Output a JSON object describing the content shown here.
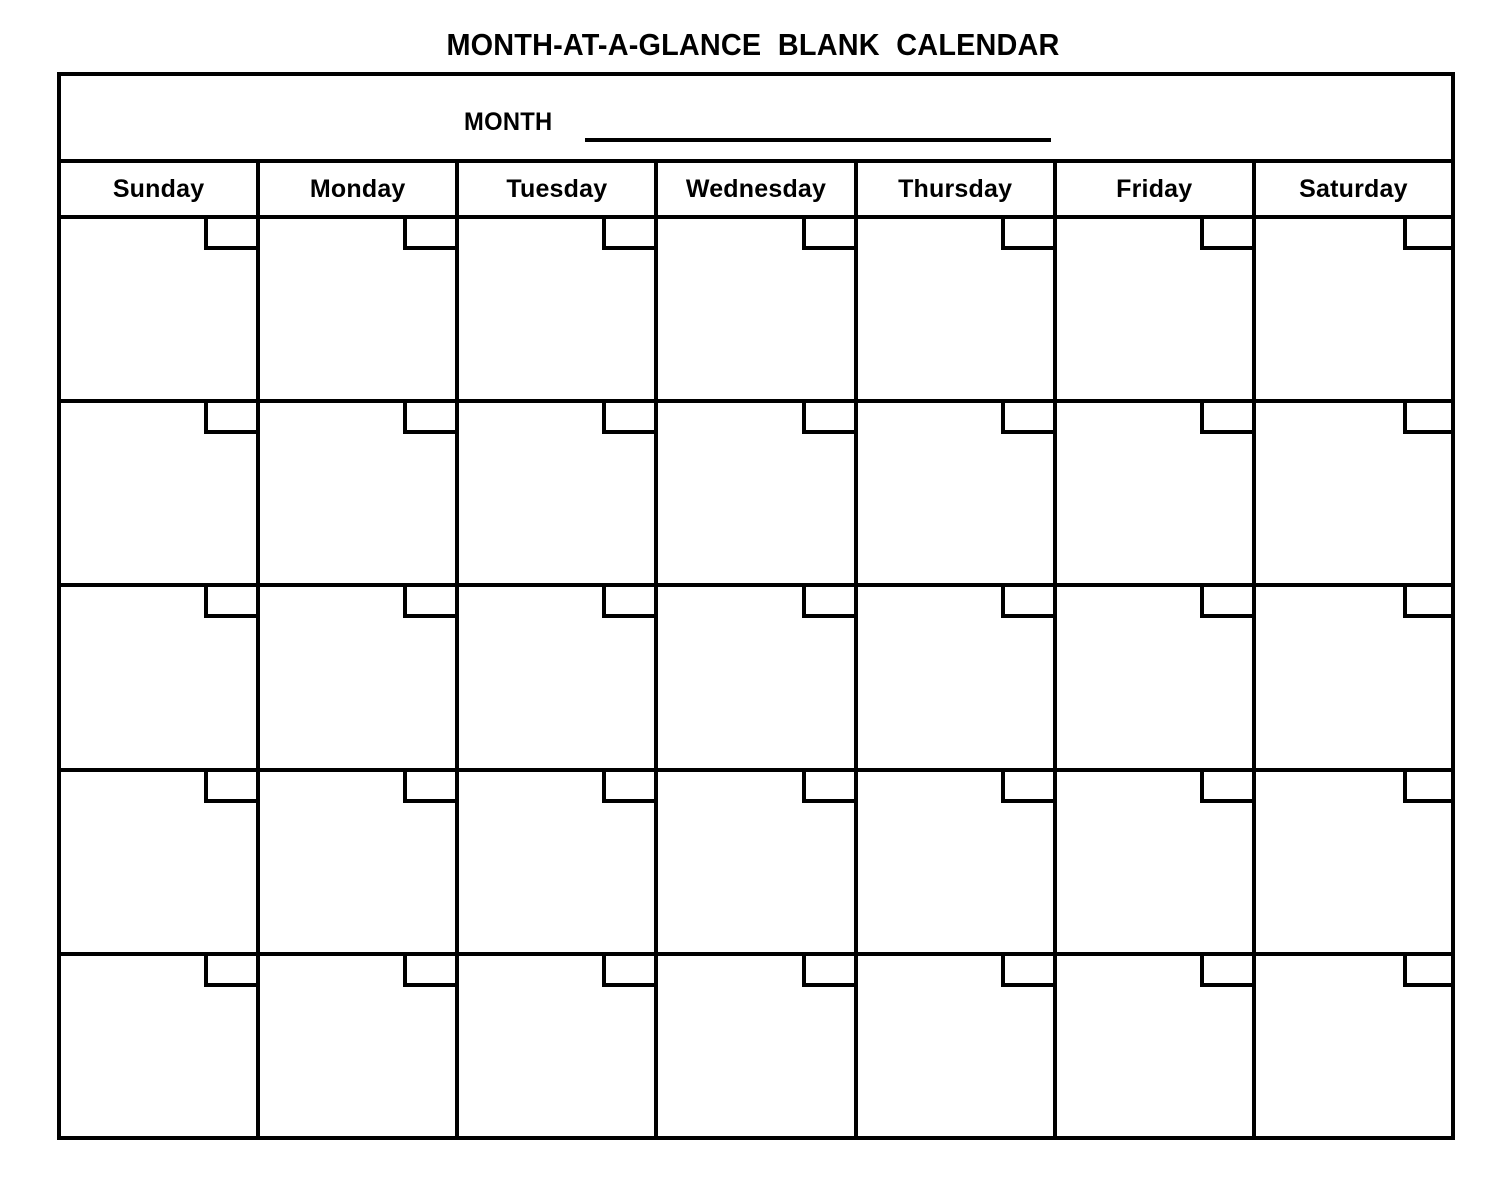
{
  "document": {
    "title": "MONTH-AT-A-GLANCE  BLANK  CALENDAR"
  },
  "month_field": {
    "label": "MONTH",
    "value": "",
    "placeholder": ""
  },
  "calendar": {
    "day_headers": [
      "Sunday",
      "Monday",
      "Tuesday",
      "Wednesday",
      "Thursday",
      "Friday",
      "Saturday"
    ],
    "week_count": 5,
    "weeks": [
      {
        "days": [
          "",
          "",
          "",
          "",
          "",
          "",
          ""
        ]
      },
      {
        "days": [
          "",
          "",
          "",
          "",
          "",
          "",
          ""
        ]
      },
      {
        "days": [
          "",
          "",
          "",
          "",
          "",
          "",
          ""
        ]
      },
      {
        "days": [
          "",
          "",
          "",
          "",
          "",
          "",
          ""
        ]
      },
      {
        "days": [
          "",
          "",
          "",
          "",
          "",
          "",
          ""
        ]
      }
    ]
  },
  "colors": {
    "ink": "#000000",
    "paper": "#ffffff"
  }
}
